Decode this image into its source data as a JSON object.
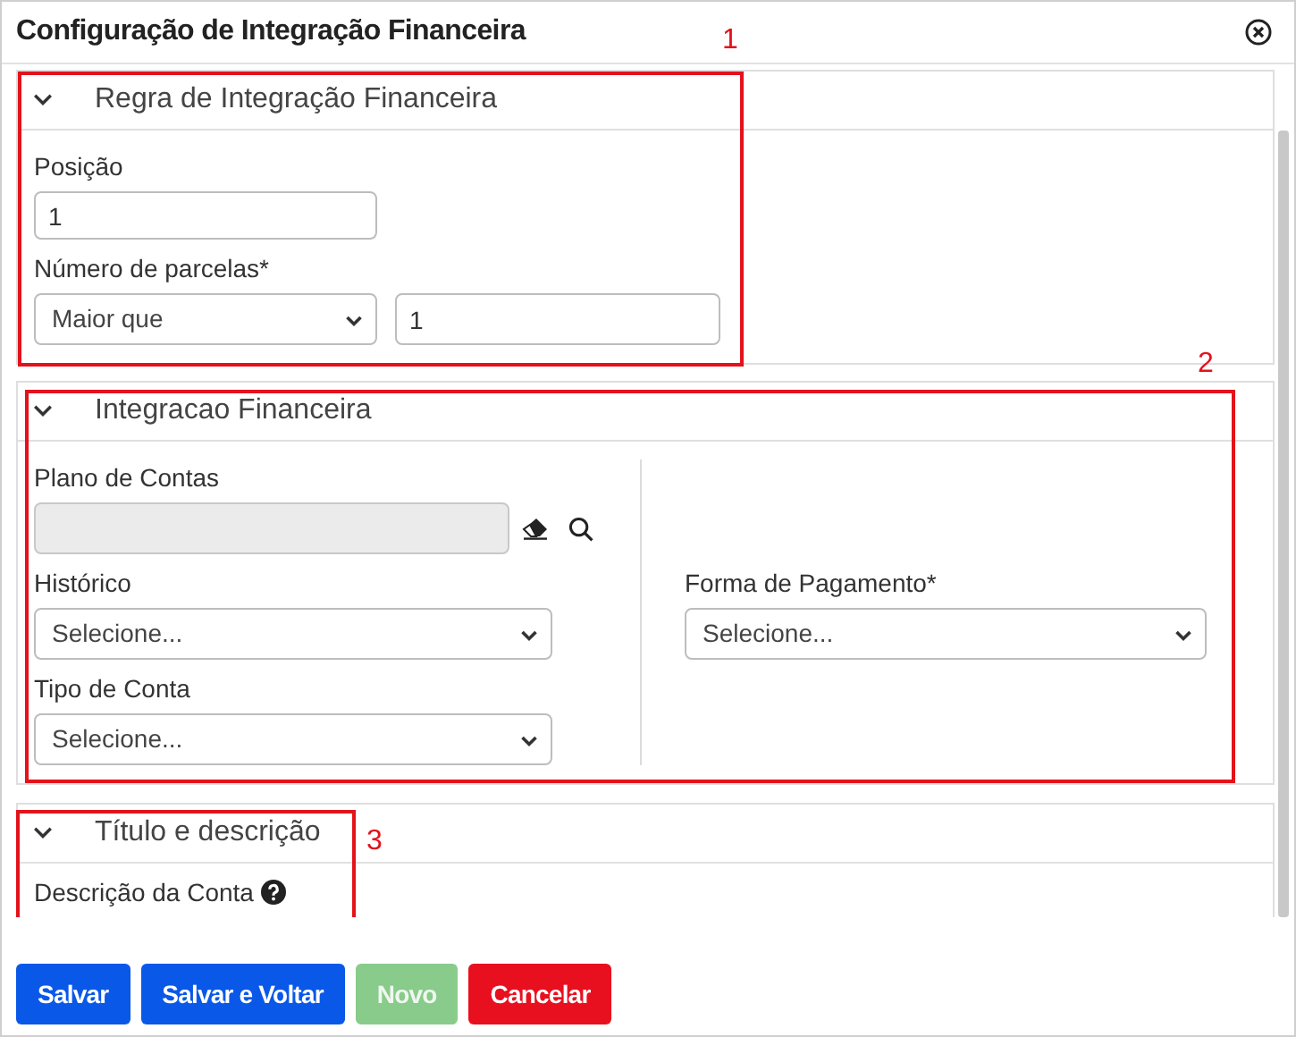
{
  "dialog": {
    "title": "Configuração de Integração Financeira"
  },
  "sections": [
    {
      "title": "Regra de Integração Financeira",
      "expanded": true,
      "annotation": "1",
      "columns": [
        [
          {
            "kind": "text",
            "label": "Posição",
            "value": "1"
          },
          {
            "kind": "select-text",
            "label": "Número de parcelas*",
            "select": "Maior que",
            "value": "1"
          }
        ]
      ]
    },
    {
      "title": "Integracao Financeira",
      "expanded": true,
      "annotation": "2",
      "columns": [
        [
          {
            "kind": "lookup",
            "label": "Plano de Contas",
            "disabled": true
          },
          {
            "kind": "select",
            "label": "Histórico",
            "select": "Selecione..."
          },
          {
            "kind": "select",
            "label": "Tipo de Conta",
            "select": "Selecione..."
          }
        ],
        [
          {
            "kind": "select",
            "label": "Forma de Pagamento*",
            "select": "Selecione..."
          }
        ]
      ]
    },
    {
      "title": "Título e descrição",
      "expanded": true,
      "annotation": "3",
      "columns": [
        [
          {
            "kind": "help-label",
            "label": "Descrição da Conta"
          }
        ]
      ]
    }
  ],
  "buttons": [
    {
      "label": "Salvar",
      "kind": "primary",
      "disabled": false
    },
    {
      "label": "Salvar e Voltar",
      "kind": "primary",
      "disabled": false
    },
    {
      "label": "Novo",
      "kind": "success",
      "disabled": true
    },
    {
      "label": "Cancelar",
      "kind": "danger",
      "disabled": false
    }
  ]
}
